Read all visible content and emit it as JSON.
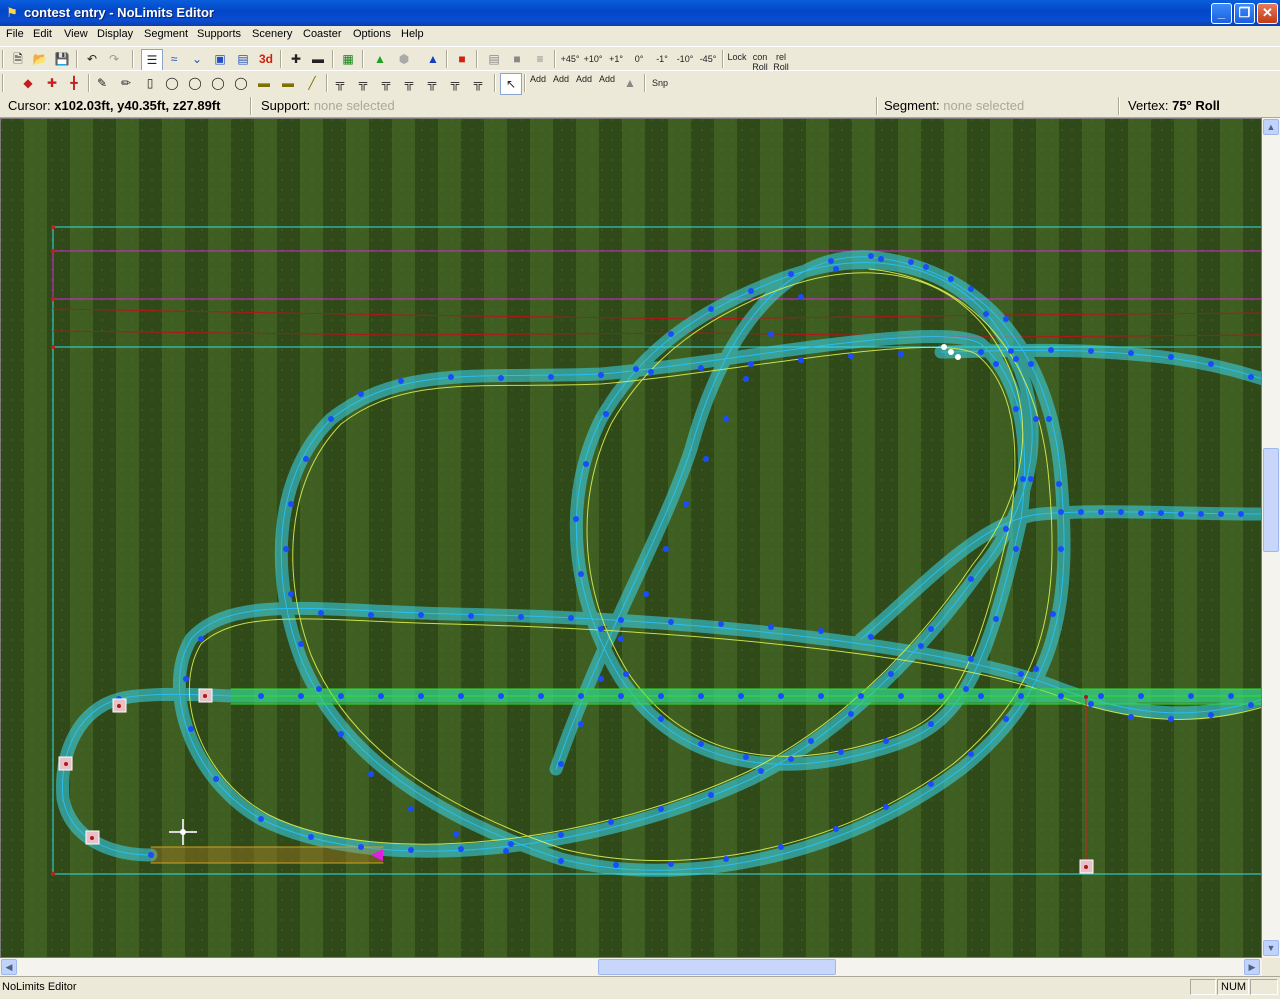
{
  "window": {
    "title": "contest entry - NoLimits Editor",
    "minimize": "_",
    "maximize": "❐",
    "close": "✕"
  },
  "menu": [
    "File",
    "Edit",
    "View",
    "Display",
    "Segment",
    "Supports",
    "Scenery",
    "Coaster",
    "Options",
    "Help"
  ],
  "toolbar1": {
    "threeD_label": "3d",
    "roll_labels": [
      "+45°",
      "+10°",
      "+1°",
      "0°",
      "-1°",
      "-10°",
      "-45°"
    ],
    "lock_label": "Lock",
    "con_roll_label": "con Roll",
    "rel_roll_label": "rel Roll"
  },
  "toolbar2": {
    "add_labels": [
      "Add",
      "Add",
      "Add",
      "Add"
    ],
    "snap_label": "Snp"
  },
  "status": {
    "cursor_label": "Cursor:",
    "cursor_value": "x102.03ft, y40.35ft, z27.89ft",
    "support_label": "Support:",
    "support_value": "none selected",
    "segment_label": "Segment:",
    "segment_value": "none selected",
    "vertex_label": "Vertex:",
    "vertex_value": "75° Roll"
  },
  "statusbar": {
    "text": "NoLimits Editor",
    "num": "NUM"
  },
  "colors": {
    "grass_dark": "#2e4a17",
    "grass_light": "#4a6b2a",
    "track_cyan": "#38d8f0",
    "track_yellow": "#d8f050",
    "vertex_blue": "#1a4cff",
    "station_green": "#30e030",
    "boundary_cyan": "#30e0e0",
    "boundary_magenta": "#e020e0",
    "boundary_red": "#c02020"
  }
}
